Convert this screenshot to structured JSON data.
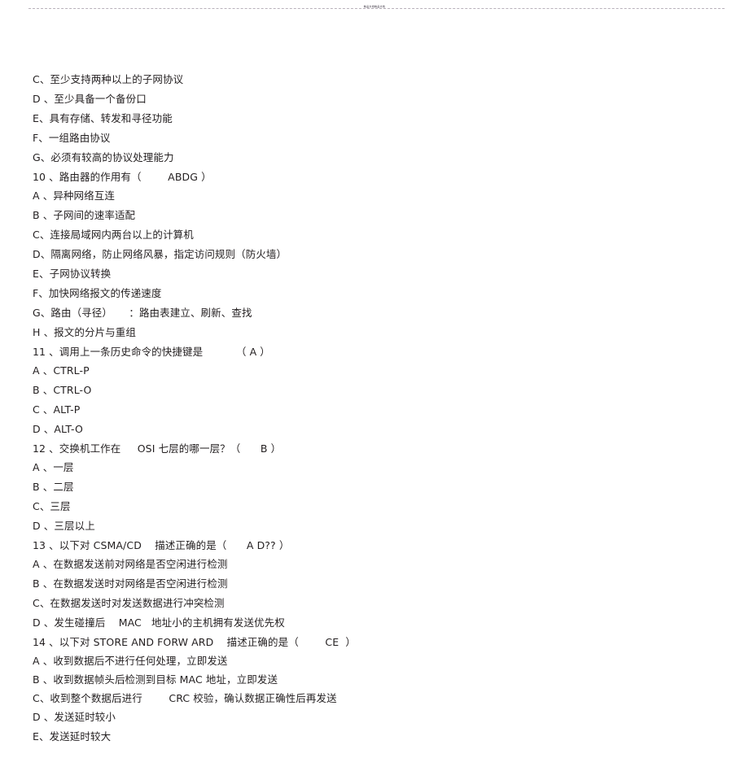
{
  "page": {
    "header_microtext": "精品文档精品文档",
    "rule_color": "#b9b2bb",
    "text_color": "#231f20",
    "background": "#ffffff"
  },
  "document": {
    "lines": [
      {
        "id": "l01",
        "text": "C、至少支持两种以上的子网协议"
      },
      {
        "id": "l02",
        "text": "D 、至少具备一个备份口"
      },
      {
        "id": "l03",
        "text": "E、具有存储、转发和寻径功能"
      },
      {
        "id": "l04",
        "text": "F、一组路由协议"
      },
      {
        "id": "l05",
        "text": "G、必须有较高的协议处理能力"
      },
      {
        "id": "l06",
        "text": "10 、路由器的作用有（        ABDG ）"
      },
      {
        "id": "l07",
        "text": "A 、异种网络互连"
      },
      {
        "id": "l08",
        "text": "B 、子网间的速率适配"
      },
      {
        "id": "l09",
        "text": "C、连接局域网内两台以上的计算机"
      },
      {
        "id": "l10",
        "text": "D、隔离网络，防止网络风暴，指定访问规则（防火墙）"
      },
      {
        "id": "l11",
        "text": "E、子网协议转换"
      },
      {
        "id": "l12",
        "text": "F、加快网络报文的传递速度"
      },
      {
        "id": "l13",
        "text": "G、路由（寻径）     ：路由表建立、刷新、查找"
      },
      {
        "id": "l14",
        "text": "H 、报文的分片与重组"
      },
      {
        "id": "l15",
        "text": "11 、调用上一条历史命令的快捷键是          （ A ）"
      },
      {
        "id": "l16",
        "text": "A 、CTRL-P"
      },
      {
        "id": "l17",
        "text": "B 、CTRL-O"
      },
      {
        "id": "l18",
        "text": "C 、ALT-P"
      },
      {
        "id": "l19",
        "text": "D 、ALT-O"
      },
      {
        "id": "l20",
        "text": "12 、交换机工作在     OSI 七层的哪一层？（      B ）"
      },
      {
        "id": "l21",
        "text": "A 、一层"
      },
      {
        "id": "l22",
        "text": "B 、二层"
      },
      {
        "id": "l23",
        "text": "C、三层"
      },
      {
        "id": "l24",
        "text": "D 、三层以上"
      },
      {
        "id": "l25",
        "text": "13 、以下对 CSMA/CD    描述正确的是（      A D?? ）"
      },
      {
        "id": "l26",
        "text": "A 、在数据发送前对网络是否空闲进行检测"
      },
      {
        "id": "l27",
        "text": "B 、在数据发送时对网络是否空闲进行检测"
      },
      {
        "id": "l28",
        "text": "C、在数据发送时对发送数据进行冲突检测"
      },
      {
        "id": "l29",
        "text": "D 、发生碰撞后    MAC   地址小的主机拥有发送优先权"
      },
      {
        "id": "l30",
        "text": "14 、以下对 STORE AND FORW ARD    描述正确的是（        CE  ）"
      },
      {
        "id": "l31",
        "text": "A 、收到数据后不进行任何处理，立即发送"
      },
      {
        "id": "l32",
        "text": "B 、收到数据帧头后检测到目标 MAC 地址，立即发送"
      },
      {
        "id": "l33",
        "text": "C、收到整个数据后进行        CRC 校验，确认数据正确性后再发送"
      },
      {
        "id": "l34",
        "text": "D 、发送延时较小"
      },
      {
        "id": "l35",
        "text": "E、发送延时较大"
      }
    ]
  }
}
